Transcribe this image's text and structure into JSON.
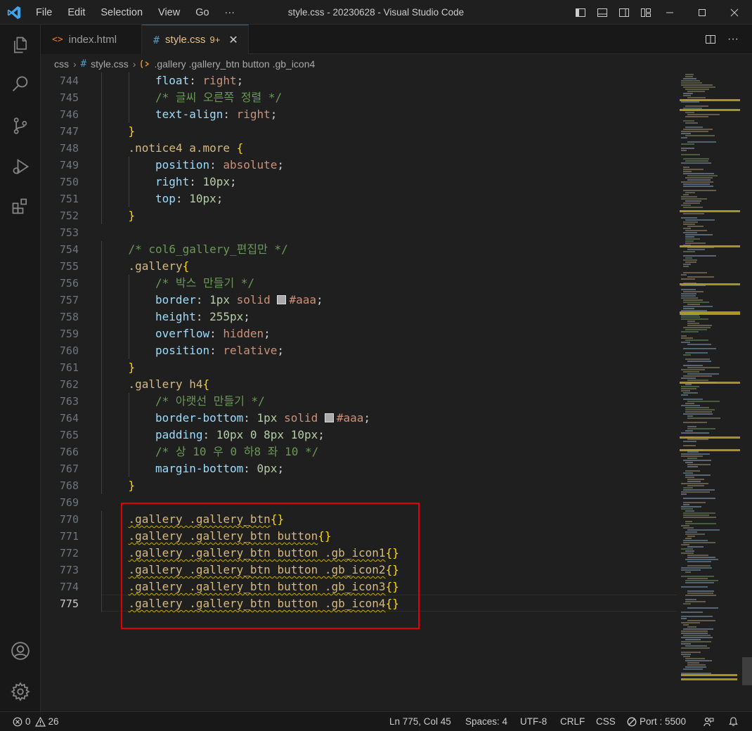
{
  "titlebar": {
    "menus": [
      "File",
      "Edit",
      "Selection",
      "View",
      "Go",
      "···"
    ],
    "title": "style.css - 20230628 - Visual Studio Code"
  },
  "activity_bar": {
    "icons": [
      "explorer-icon",
      "search-icon",
      "source-control-icon",
      "run-debug-icon",
      "extensions-icon",
      "account-icon",
      "settings-gear-icon"
    ]
  },
  "tabs": [
    {
      "label": "index.html",
      "icon": "<>",
      "active": false
    },
    {
      "label": "style.css",
      "icon": "#",
      "active": true,
      "modified": "9+",
      "close": "✕"
    }
  ],
  "breadcrumb": [
    "css",
    "#",
    "style.css",
    ".gallery .gallery_btn button .gb_icon4"
  ],
  "editor": {
    "lines": [
      {
        "num": "744",
        "indent": 2,
        "tokens": [
          [
            "prop",
            "float"
          ],
          [
            "pun",
            ": "
          ],
          [
            "val",
            "right"
          ],
          [
            "pun",
            ";"
          ]
        ]
      },
      {
        "num": "745",
        "indent": 2,
        "tokens": [
          [
            "com",
            "/* 글씨 오른쪽 정렬 */"
          ]
        ]
      },
      {
        "num": "746",
        "indent": 2,
        "tokens": [
          [
            "prop",
            "text-align"
          ],
          [
            "pun",
            ": "
          ],
          [
            "val",
            "right"
          ],
          [
            "pun",
            ";"
          ]
        ]
      },
      {
        "num": "747",
        "indent": 1,
        "tokens": [
          [
            "br",
            "}"
          ]
        ]
      },
      {
        "num": "748",
        "indent": 1,
        "tokens": [
          [
            "sel",
            ".notice4 a.more "
          ],
          [
            "br",
            "{"
          ]
        ]
      },
      {
        "num": "749",
        "indent": 2,
        "tokens": [
          [
            "prop",
            "position"
          ],
          [
            "pun",
            ": "
          ],
          [
            "val",
            "absolute"
          ],
          [
            "pun",
            ";"
          ]
        ]
      },
      {
        "num": "750",
        "indent": 2,
        "tokens": [
          [
            "prop",
            "right"
          ],
          [
            "pun",
            ": "
          ],
          [
            "num",
            "10px"
          ],
          [
            "pun",
            ";"
          ]
        ]
      },
      {
        "num": "751",
        "indent": 2,
        "tokens": [
          [
            "prop",
            "top"
          ],
          [
            "pun",
            ": "
          ],
          [
            "num",
            "10px"
          ],
          [
            "pun",
            ";"
          ]
        ]
      },
      {
        "num": "752",
        "indent": 1,
        "tokens": [
          [
            "br",
            "}"
          ]
        ]
      },
      {
        "num": "753",
        "indent": 0,
        "tokens": []
      },
      {
        "num": "754",
        "indent": 1,
        "tokens": [
          [
            "com",
            "/* col6_gallery_편집만 */"
          ]
        ]
      },
      {
        "num": "755",
        "indent": 1,
        "tokens": [
          [
            "sel",
            ".gallery"
          ],
          [
            "br",
            "{"
          ]
        ]
      },
      {
        "num": "756",
        "indent": 2,
        "tokens": [
          [
            "com",
            "/* 박스 만들기 */"
          ]
        ]
      },
      {
        "num": "757",
        "indent": 2,
        "tokens": [
          [
            "prop",
            "border"
          ],
          [
            "pun",
            ": "
          ],
          [
            "num",
            "1px"
          ],
          [
            "pun",
            " "
          ],
          [
            "val",
            "solid"
          ],
          [
            "pun",
            " "
          ],
          [
            "swatch",
            ""
          ],
          [
            "val",
            "#aaa"
          ],
          [
            "pun",
            ";"
          ]
        ]
      },
      {
        "num": "758",
        "indent": 2,
        "tokens": [
          [
            "prop",
            "height"
          ],
          [
            "pun",
            ": "
          ],
          [
            "num",
            "255px"
          ],
          [
            "pun",
            ";"
          ]
        ]
      },
      {
        "num": "759",
        "indent": 2,
        "tokens": [
          [
            "prop",
            "overflow"
          ],
          [
            "pun",
            ": "
          ],
          [
            "val",
            "hidden"
          ],
          [
            "pun",
            ";"
          ]
        ]
      },
      {
        "num": "760",
        "indent": 2,
        "tokens": [
          [
            "prop",
            "position"
          ],
          [
            "pun",
            ": "
          ],
          [
            "val",
            "relative"
          ],
          [
            "pun",
            ";"
          ]
        ]
      },
      {
        "num": "761",
        "indent": 1,
        "tokens": [
          [
            "br",
            "}"
          ]
        ]
      },
      {
        "num": "762",
        "indent": 1,
        "tokens": [
          [
            "sel",
            ".gallery h4"
          ],
          [
            "br",
            "{"
          ]
        ]
      },
      {
        "num": "763",
        "indent": 2,
        "tokens": [
          [
            "com",
            "/* 아랫선 만들기 */"
          ]
        ]
      },
      {
        "num": "764",
        "indent": 2,
        "tokens": [
          [
            "prop",
            "border-bottom"
          ],
          [
            "pun",
            ": "
          ],
          [
            "num",
            "1px"
          ],
          [
            "pun",
            " "
          ],
          [
            "val",
            "solid"
          ],
          [
            "pun",
            " "
          ],
          [
            "swatch",
            ""
          ],
          [
            "val",
            "#aaa"
          ],
          [
            "pun",
            ";"
          ]
        ]
      },
      {
        "num": "765",
        "indent": 2,
        "tokens": [
          [
            "prop",
            "padding"
          ],
          [
            "pun",
            ": "
          ],
          [
            "num",
            "10px 0 8px 10px"
          ],
          [
            "pun",
            ";"
          ]
        ]
      },
      {
        "num": "766",
        "indent": 2,
        "tokens": [
          [
            "com",
            "/* 상 10 우 0 하8 좌 10 */"
          ]
        ]
      },
      {
        "num": "767",
        "indent": 2,
        "tokens": [
          [
            "prop",
            "margin-bottom"
          ],
          [
            "pun",
            ": "
          ],
          [
            "num",
            "0px"
          ],
          [
            "pun",
            ";"
          ]
        ]
      },
      {
        "num": "768",
        "indent": 1,
        "tokens": [
          [
            "br",
            "}"
          ]
        ]
      },
      {
        "num": "769",
        "indent": 0,
        "tokens": []
      },
      {
        "num": "770",
        "indent": 1,
        "tokens": [
          [
            "sqsel",
            ".gallery .gallery_btn"
          ],
          [
            "br",
            "{}"
          ]
        ]
      },
      {
        "num": "771",
        "indent": 1,
        "tokens": [
          [
            "sqsel",
            ".gallery .gallery_btn button"
          ],
          [
            "br",
            "{}"
          ]
        ]
      },
      {
        "num": "772",
        "indent": 1,
        "tokens": [
          [
            "sqsel",
            ".gallery .gallery_btn button .gb_icon1"
          ],
          [
            "br",
            "{}"
          ]
        ]
      },
      {
        "num": "773",
        "indent": 1,
        "tokens": [
          [
            "sqsel",
            ".gallery .gallery_btn button .gb_icon2"
          ],
          [
            "br",
            "{}"
          ]
        ]
      },
      {
        "num": "774",
        "indent": 1,
        "tokens": [
          [
            "sqsel",
            ".gallery .gallery_btn button .gb_icon3"
          ],
          [
            "br",
            "{}"
          ]
        ]
      },
      {
        "num": "775",
        "indent": 1,
        "tokens": [
          [
            "sqsel",
            ".gallery .gallery_btn button .gb_icon4"
          ],
          [
            "br",
            "{}"
          ]
        ],
        "current": true
      }
    ]
  },
  "status": {
    "errors": "0",
    "warnings": "26",
    "position": "Ln 775, Col 45",
    "spaces": "Spaces: 4",
    "encoding": "UTF-8",
    "eol": "CRLF",
    "language": "CSS",
    "port": "Port : 5500"
  },
  "colors": {
    "accent": "#0078d4",
    "highlight_box": "#e00000",
    "squiggle": "#cca700",
    "modified_tab": "#e2c08d"
  }
}
